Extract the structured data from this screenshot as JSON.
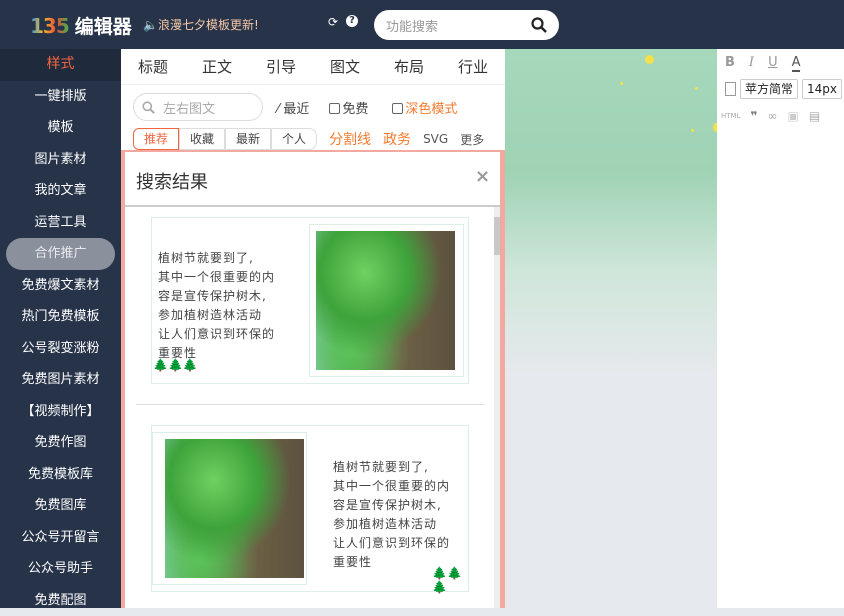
{
  "header": {
    "logo_mark": "135",
    "logo_text": "编辑器",
    "notice": "🔈浪漫七夕模板更新!",
    "refresh_icon": "⟳",
    "help_icon": "?",
    "search_placeholder": "功能搜索"
  },
  "sidebar": {
    "items": [
      "样式",
      "一键排版",
      "模板",
      "图片素材",
      "我的文章",
      "运营工具",
      "合作推广",
      "免费爆文素材",
      "热门免费模板",
      "公号裂变涨粉",
      "免费图片素材",
      "【视频制作】",
      "免费作图",
      "免费模板库",
      "免费图库",
      "公众号开留言",
      "公众号助手",
      "免费配图"
    ]
  },
  "panel": {
    "tabs": [
      "标题",
      "正文",
      "引导",
      "图文",
      "布局",
      "行业"
    ],
    "search_placeholder": "左右图文",
    "recent": "最近",
    "free": "免费",
    "dark_mode": "深色模式",
    "subtabs": [
      "推荐",
      "收藏",
      "最新",
      "个人"
    ],
    "extra": [
      "分割线",
      "政务"
    ],
    "svg": "SVG",
    "more": "更多"
  },
  "dialog": {
    "title": "搜索结果",
    "close": "×",
    "cards": [
      {
        "lines": [
          "植树节就要到了,",
          "其中一个很重要的内",
          "容是宣传保护树木,",
          "参加植树造林活动",
          "让人们意识到环保的",
          "重要性"
        ]
      },
      {
        "lines": [
          "植树节就要到了,",
          "其中一个很重要的内",
          "容是宣传保护树木,",
          "参加植树造林活动",
          "让人们意识到环保的",
          "重要性"
        ]
      }
    ]
  },
  "editor": {
    "bold": "B",
    "italic": "I",
    "underline": "U",
    "fontcolor": "A",
    "font": "苹方简常",
    "size": "14px",
    "html": "HTML",
    "quote": "❞"
  },
  "colors": {
    "header": "#263349",
    "accent": "#f0663f",
    "border": "#f4a9a0"
  }
}
